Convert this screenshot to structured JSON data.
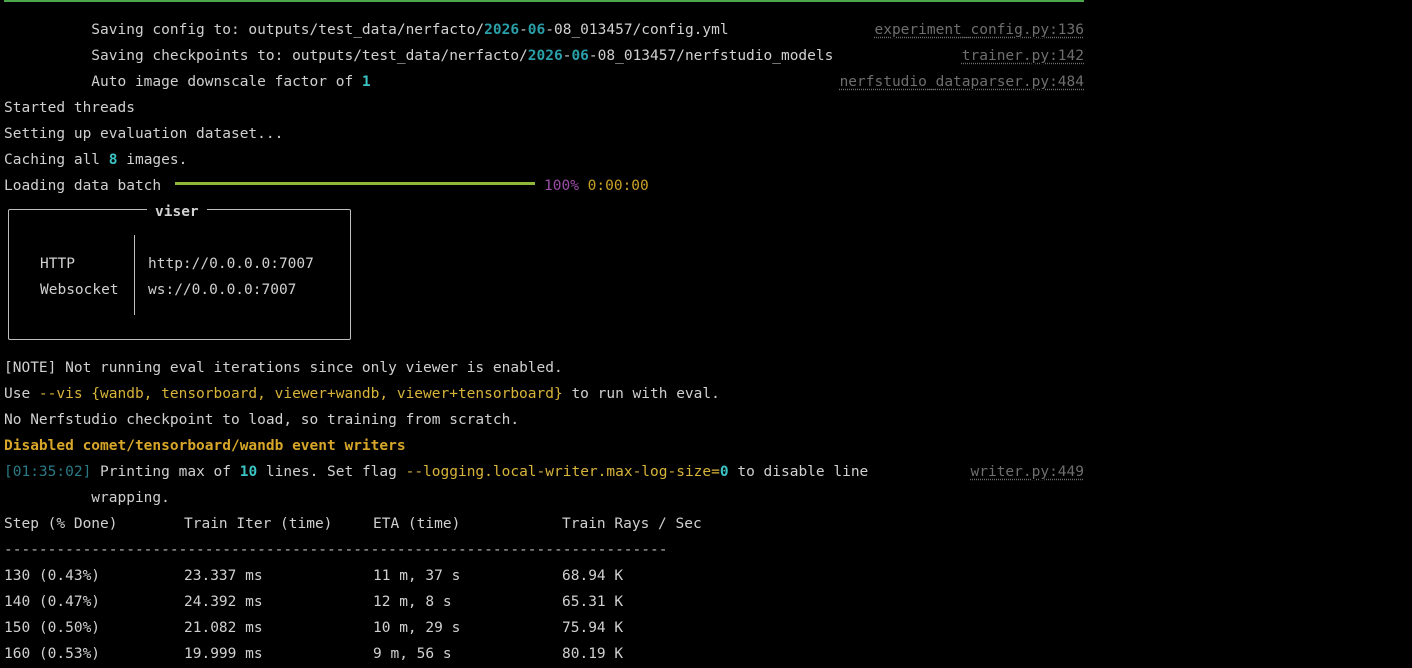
{
  "log": {
    "l1": {
      "pre": "          Saving config to: outputs/test_data/nerfacto/",
      "year": "2026",
      "dash1": "-",
      "month": "06",
      "post": "-08_013457/config.yml",
      "src": "experiment_config.py:136"
    },
    "l2": {
      "pre": "          Saving checkpoints to: outputs/test_data/nerfacto/",
      "year": "2026",
      "dash1": "-",
      "month": "06",
      "post": "-08_013457/nerfstudio_models",
      "src": "trainer.py:142"
    },
    "l3": {
      "pre": "          Auto image downscale factor of ",
      "num": "1",
      "src": "nerfstudio_dataparser.py:484"
    },
    "l4": "Started threads",
    "l5": "Setting up evaluation dataset...",
    "l6": {
      "pre": "Caching all ",
      "num": "8",
      "post": " images."
    },
    "l7": {
      "label": "Loading data batch",
      "pct": "100%",
      "time": "0:00:00",
      "progress": 1.0
    }
  },
  "viser": {
    "title": "viser",
    "rows": [
      {
        "key": "HTTP",
        "value": "http://0.0.0.0:7007"
      },
      {
        "key": "Websocket",
        "value": "ws://0.0.0.0:7007"
      }
    ]
  },
  "notes": {
    "n1": {
      "bracket": "[NOTE]",
      "text": " Not running eval iterations since only viewer is enabled."
    },
    "n2": {
      "pre": "Use ",
      "flag": "--vis {wandb, tensorboard, viewer+wandb, viewer+tensorboard}",
      "post": " to run with eval."
    },
    "n3": "No Nerfstudio checkpoint to load, so training from scratch.",
    "n4": "Disabled comet/tensorboard/wandb event writers",
    "n5": {
      "time": "[01:35:02]",
      "pre": " Printing max of ",
      "num": "10",
      "mid": " lines. Set flag ",
      "flag": "--logging.local-writer.max-log-size=",
      "zero": "0",
      "post": " to disable line",
      "src": "writer.py:449"
    },
    "n6": "          wrapping."
  },
  "table": {
    "headers": [
      "Step (% Done)",
      "Train Iter (time)",
      "ETA (time)",
      "Train Rays / Sec"
    ],
    "divider": "----------------------------------------------------------------------------",
    "rows": [
      [
        "130 (0.43%)",
        "23.337 ms",
        "11 m, 37 s",
        "68.94 K"
      ],
      [
        "140 (0.47%)",
        "24.392 ms",
        "12 m, 8 s",
        "65.31 K"
      ],
      [
        "150 (0.50%)",
        "21.082 ms",
        "10 m, 29 s",
        "75.94 K"
      ],
      [
        "160 (0.53%)",
        "19.999 ms",
        "9 m, 56 s",
        "80.19 K"
      ]
    ]
  },
  "colors": {
    "accent_cyan": "#3cc3c3",
    "warning_yellow": "#d8a72a",
    "progress_green": "#8fb83a",
    "rule_green": "#4ca64c"
  }
}
